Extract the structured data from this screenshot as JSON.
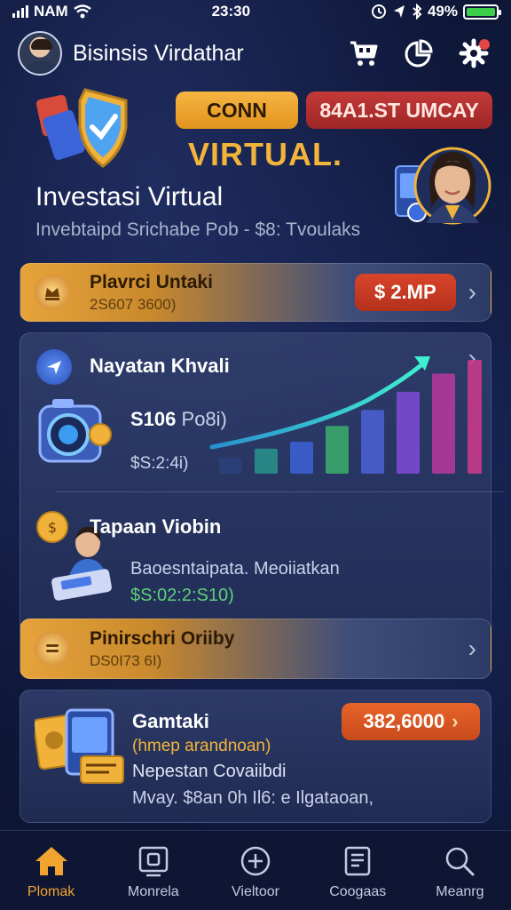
{
  "status_bar": {
    "carrier": "NAM",
    "time": "23:30",
    "battery": "49%"
  },
  "header": {
    "title": "Bisinsis Virdathar"
  },
  "hero": {
    "btn_primary": "CONN",
    "btn_secondary": "84A1.ST UMCAY",
    "banner_word": "VIRTUAL.",
    "title": "Investasi Virtual",
    "subtitle": "Invebtaipd Srichabe Pob - $8: Tvoulaks"
  },
  "card_one": {
    "title": "Plavrci Untaki",
    "subtitle": "2S607 3600)",
    "amount": "$ 2.MP"
  },
  "growth": {
    "title": "Nayatan Khvali",
    "value": "S106",
    "value_suffix": "Po8i)",
    "small": "$S:2:4i)",
    "bar_levels": [
      0.14,
      0.22,
      0.28,
      0.42,
      0.56,
      0.72,
      0.88,
      1.0
    ]
  },
  "tapaan": {
    "title": "Tapaan Viobin",
    "line1": "Baoesntaipata. Meoiiatkan",
    "line2": "$S:02:2:S10)"
  },
  "card_two": {
    "title": "Pinirschri Oriiby",
    "subtitle": "DS0I73 6I)"
  },
  "gamtaki": {
    "title": "Gamtaki",
    "paren": "(hmep arandnoan)",
    "line1": "Nepestan Covaiibdi",
    "line2": "Mvay. $8an 0h Il6: e Ilgataoan,",
    "amount": "382,6000"
  },
  "nav": [
    {
      "label": "Plomak",
      "icon": "home-icon",
      "active": true
    },
    {
      "label": "Monrela",
      "icon": "portfolio-icon",
      "active": false
    },
    {
      "label": "Vieltoor",
      "icon": "add-circle-icon",
      "active": false
    },
    {
      "label": "Coogaas",
      "icon": "document-icon",
      "active": false
    },
    {
      "label": "Meanrg",
      "icon": "search-icon",
      "active": false
    }
  ],
  "colors": {
    "accent": "#f2a430",
    "background": "#0d1533",
    "danger": "#c43a3a"
  }
}
